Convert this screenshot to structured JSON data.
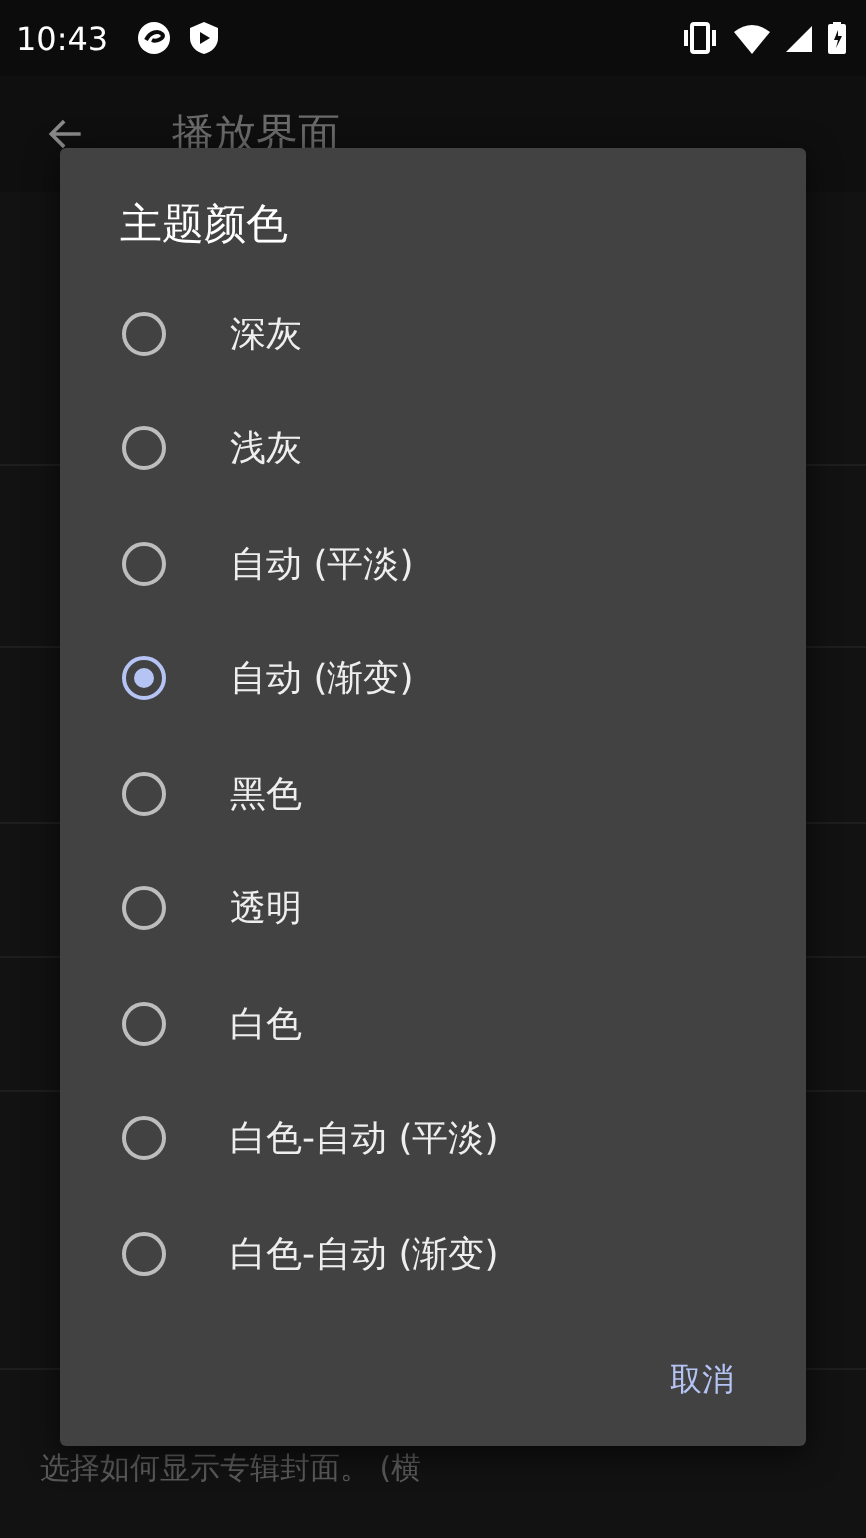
{
  "status_bar": {
    "time": "10:43"
  },
  "toolbar": {
    "title": "播放界面"
  },
  "background_list": [
    {
      "kind": "header"
    },
    {
      "kind": "item"
    },
    {
      "kind": "item"
    },
    {
      "kind": "item"
    },
    {
      "kind": "item"
    },
    {
      "kind": "item"
    },
    {
      "kind": "header"
    },
    {
      "kind": "item"
    },
    {
      "kind": "item",
      "summary": "选择如何显示专辑封面。 (横"
    }
  ],
  "dialog": {
    "title": "主题颜色",
    "options": [
      {
        "label": "深灰",
        "selected": false
      },
      {
        "label": "浅灰",
        "selected": false
      },
      {
        "label": "自动 (平淡)",
        "selected": false
      },
      {
        "label": "自动 (渐变)",
        "selected": true
      },
      {
        "label": "黑色",
        "selected": false
      },
      {
        "label": "透明",
        "selected": false
      },
      {
        "label": "白色",
        "selected": false
      },
      {
        "label": "白色-自动 (平淡)",
        "selected": false
      },
      {
        "label": "白色-自动 (渐变)",
        "selected": false
      }
    ],
    "buttons": [
      "取消"
    ]
  }
}
